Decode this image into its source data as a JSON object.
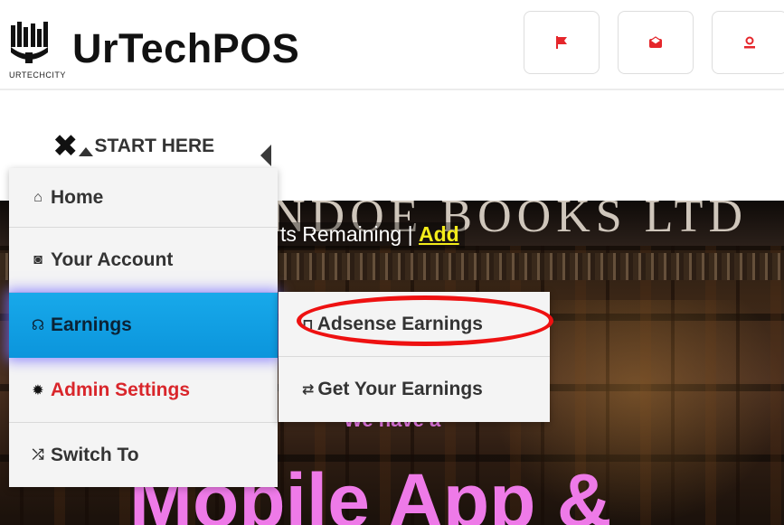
{
  "header": {
    "logo_title": "UrTechPOS",
    "logo_subtitle": "URTECHCITY",
    "buttons": [
      {
        "name": "flag-button",
        "icon": "flag-icon",
        "color": "#e5262b"
      },
      {
        "name": "messages-button",
        "icon": "envelope-icon",
        "color": "#e5262b"
      },
      {
        "name": "user-button",
        "icon": "user-icon",
        "color": "#e5262b"
      }
    ]
  },
  "start_here": {
    "label": "START HERE",
    "icon": "close-icon"
  },
  "menu": {
    "items": [
      {
        "label": "Home",
        "icon": "home-icon"
      },
      {
        "label": "Your Account",
        "icon": "account-icon"
      },
      {
        "label": "Earnings",
        "icon": "earnings-icon",
        "active": true
      },
      {
        "label": "Admin Settings",
        "icon": "gear-icon"
      },
      {
        "label": "Switch To",
        "icon": "shuffle-icon"
      }
    ]
  },
  "submenu": {
    "items": [
      {
        "label": "Adsense Earnings",
        "icon": "bookmark-icon",
        "highlighted": true
      },
      {
        "label": "Get Your Earnings",
        "icon": "exchange-icon"
      }
    ]
  },
  "hero": {
    "sign_text": "NDOE BOOKS LTD",
    "remaining_text": "ts Remaining | ",
    "add_link": "Add",
    "tagline": "We have a",
    "headline": "Mobile App &"
  },
  "colors": {
    "accent": "#0b95dc",
    "admin_red": "#d9262b",
    "highlight_ring": "#ee1111",
    "promo_pink": "#ee7ae8"
  }
}
